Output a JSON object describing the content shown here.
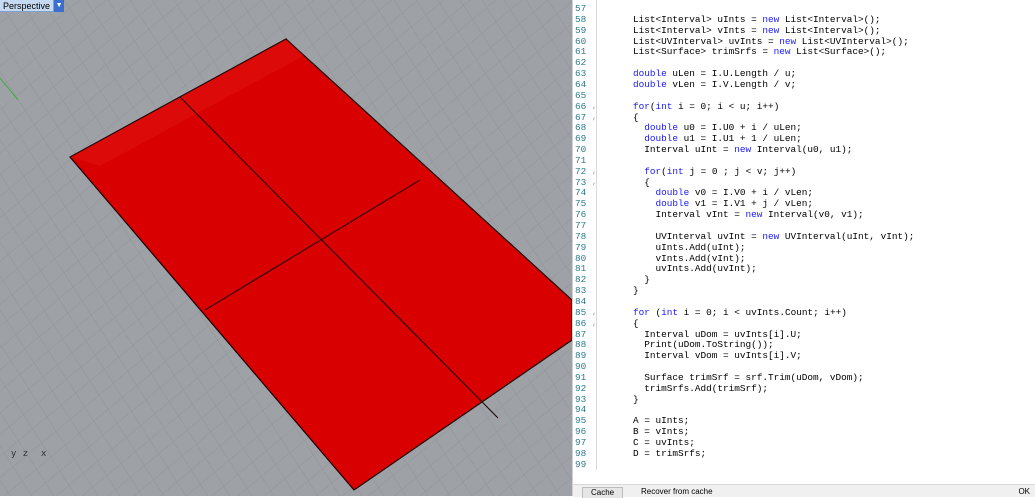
{
  "viewport": {
    "label": "Perspective",
    "dropdown_arrow": "▼",
    "axis_labels": {
      "y": "y",
      "z": "z",
      "x": "x"
    }
  },
  "editor": {
    "lines": [
      {
        "n": "57",
        "t": ""
      },
      {
        "n": "58",
        "t": "List<Interval> uInts = new List<Interval>();"
      },
      {
        "n": "59",
        "t": "List<Interval> vInts = new List<Interval>();"
      },
      {
        "n": "60",
        "t": "List<UVInterval> uvInts = new List<UVInterval>();"
      },
      {
        "n": "61",
        "t": "List<Surface> trimSrfs = new List<Surface>();"
      },
      {
        "n": "62",
        "t": ""
      },
      {
        "n": "63",
        "t": "double uLen = I.U.Length / u;"
      },
      {
        "n": "64",
        "t": "double vLen = I.V.Length / v;"
      },
      {
        "n": "65",
        "t": ""
      },
      {
        "n": "66",
        "t": "for(int i = 0; i < u; i++)"
      },
      {
        "n": "67",
        "t": "{"
      },
      {
        "n": "68",
        "t": "  double u0 = I.U0 + i / uLen;"
      },
      {
        "n": "69",
        "t": "  double u1 = I.U1 + 1 / uLen;"
      },
      {
        "n": "70",
        "t": "  Interval uInt = new Interval(u0, u1);"
      },
      {
        "n": "71",
        "t": ""
      },
      {
        "n": "72",
        "t": "  for(int j = 0 ; j < v; j++)"
      },
      {
        "n": "73",
        "t": "  {"
      },
      {
        "n": "74",
        "t": "    double v0 = I.V0 + i / vLen;"
      },
      {
        "n": "75",
        "t": "    double v1 = I.V1 + j / vLen;"
      },
      {
        "n": "76",
        "t": "    Interval vInt = new Interval(v0, v1);"
      },
      {
        "n": "77",
        "t": ""
      },
      {
        "n": "78",
        "t": "    UVInterval uvInt = new UVInterval(uInt, vInt);"
      },
      {
        "n": "79",
        "t": "    uInts.Add(uInt);"
      },
      {
        "n": "80",
        "t": "    vInts.Add(vInt);"
      },
      {
        "n": "81",
        "t": "    uvInts.Add(uvInt);"
      },
      {
        "n": "82",
        "t": "  }"
      },
      {
        "n": "83",
        "t": "}"
      },
      {
        "n": "84",
        "t": ""
      },
      {
        "n": "85",
        "t": "for (int i = 0; i < uvInts.Count; i++)"
      },
      {
        "n": "86",
        "t": "{"
      },
      {
        "n": "87",
        "t": "  Interval uDom = uvInts[i].U;"
      },
      {
        "n": "88",
        "t": "  Print(uDom.ToString());"
      },
      {
        "n": "89",
        "t": "  Interval vDom = uvInts[i].V;"
      },
      {
        "n": "90",
        "t": ""
      },
      {
        "n": "91",
        "t": "  Surface trimSrf = srf.Trim(uDom, vDom);"
      },
      {
        "n": "92",
        "t": "  trimSrfs.Add(trimSrf);"
      },
      {
        "n": "93",
        "t": "}"
      },
      {
        "n": "94",
        "t": ""
      },
      {
        "n": "95",
        "t": "A = uInts;"
      },
      {
        "n": "96",
        "t": "B = vInts;"
      },
      {
        "n": "97",
        "t": "C = uvInts;"
      },
      {
        "n": "98",
        "t": "D = trimSrfs;"
      },
      {
        "n": "99",
        "t": ""
      }
    ],
    "fold_mark": ",",
    "fold_lines": [
      "66",
      "67",
      "72",
      "73",
      "85",
      "86"
    ],
    "bottom": {
      "cache_label": "Cache",
      "recover_label": "Recover from cache",
      "ok_label": "OK"
    }
  },
  "colors": {
    "viewport_bg": "#9ea1a5",
    "grid_line": "#8f9297",
    "surface_fill": "#d80000",
    "keyword": "#1a1aff"
  }
}
